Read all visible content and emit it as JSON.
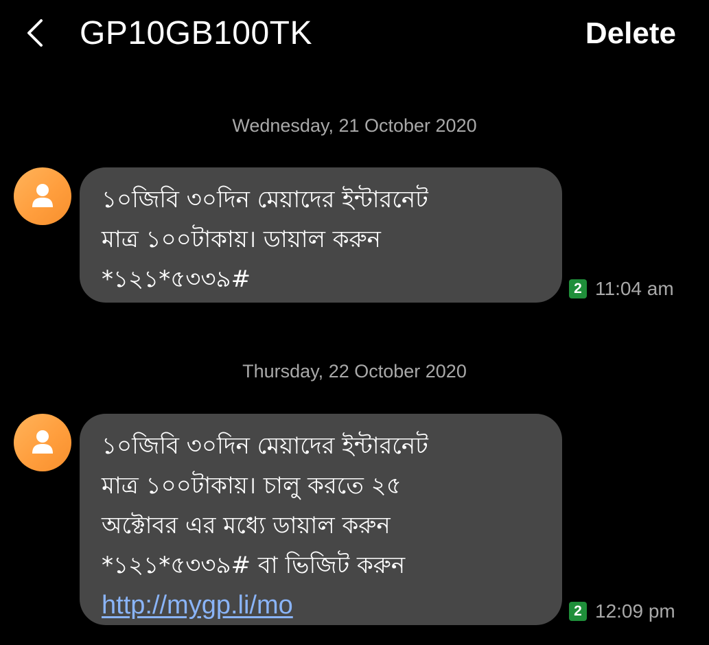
{
  "header": {
    "title": "GP10GB100TK",
    "delete_label": "Delete"
  },
  "colors": {
    "background": "#000000",
    "bubble": "#474747",
    "avatar": "#ff9e3d",
    "link": "#8ab4f8",
    "sim_badge": "#1f8f3a",
    "muted_text": "#a9a9a9"
  },
  "icons": {
    "back": "chevron-left-icon",
    "avatar": "person-icon",
    "sim": "sim-2-badge"
  },
  "messages": [
    {
      "date": "Wednesday, 21 October 2020",
      "lines": [
        "১০জিবি ৩০দিন মেয়াদের ইন্টারনেট",
        "মাত্র ১০০টাকায়। ডায়াল করুন",
        "*১২১*৫৩৩৯#"
      ],
      "sim": "2",
      "time": "11:04 am"
    },
    {
      "date": "Thursday, 22 October 2020",
      "lines": [
        "১০জিবি ৩০দিন মেয়াদের ইন্টারনেট",
        "মাত্র ১০০টাকায়। চালু করতে ২৫",
        "অক্টোবর এর মধ্যে ডায়াল করুন",
        "*১২১*৫৩৩৯# বা ভিজিট করুন"
      ],
      "link": "http://mygp.li/mo",
      "sim": "2",
      "time": "12:09 pm"
    }
  ]
}
